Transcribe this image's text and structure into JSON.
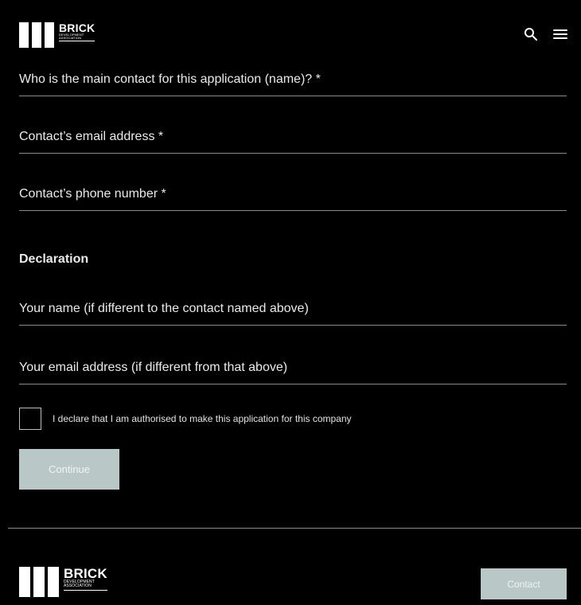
{
  "header": {
    "logo": {
      "brand": "BRICK",
      "sub_1": "DEVELOPMENT",
      "sub_2": "ASSOCIATION"
    },
    "icons": {
      "search": "search-icon",
      "menu": "menu-icon"
    }
  },
  "form": {
    "fields": [
      {
        "label": "Who is the main contact for this application (name)? *"
      },
      {
        "label": "Contact’s email address *"
      },
      {
        "label": "Contact’s phone number *"
      },
      {
        "label": "Your name (if different to the contact named above)"
      },
      {
        "label": "Your email address (if different from that above)"
      }
    ],
    "declaration_title": "Declaration",
    "checkbox_label": "I declare that I am authorised to make this application for this company",
    "continue_label": "Continue"
  },
  "footer": {
    "logo": {
      "brand": "BRICK",
      "sub_1": "DEVELOPMENT",
      "sub_2": "ASSOCIATION"
    },
    "contact_label": "Contact"
  },
  "colors": {
    "background": "#000000",
    "text": "#f2f2f2",
    "button": "#b9c7c7",
    "divider": "#8a8a8a"
  }
}
